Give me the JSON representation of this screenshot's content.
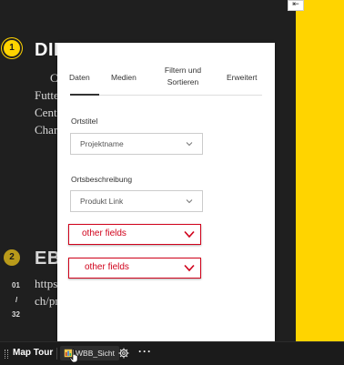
{
  "story": {
    "step1_number": "1",
    "step1_heading": "DIE",
    "step1_lines": [
      "C",
      "Futte",
      "Cent",
      "Char"
    ],
    "step2_number": "2",
    "step2_heading": "EBI",
    "step2_lines": [
      "https",
      "ch/pr"
    ],
    "counter_current": "01",
    "counter_sep": "/",
    "counter_total": "32",
    "side_button_icon": "arrow-left-icon"
  },
  "panel": {
    "tabs": [
      {
        "label": "Daten",
        "active": true
      },
      {
        "label": "Medien",
        "active": false
      },
      {
        "label": "Filtern und Sortieren",
        "active": false
      },
      {
        "label": "Erweitert",
        "active": false
      }
    ],
    "fields": [
      {
        "label": "Ortstitel",
        "value": "Projektname"
      },
      {
        "label": "Ortsbeschreibung",
        "value": "Produkt Link"
      }
    ],
    "annotations": [
      {
        "text": "other fields"
      },
      {
        "text": "other fields"
      }
    ]
  },
  "bottom_bar": {
    "title": "Map Tour",
    "layer_name": "WBB_Sicht",
    "more_label": "···"
  },
  "colors": {
    "accent_yellow": "#ffd400",
    "annotation_red": "#d0021b",
    "dark_bg": "#1f1f1f"
  }
}
